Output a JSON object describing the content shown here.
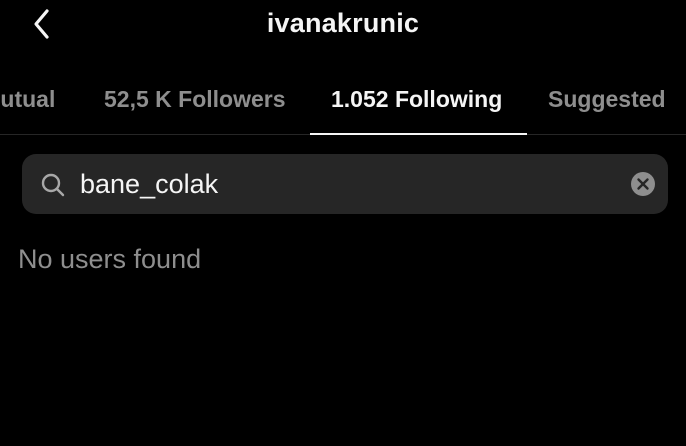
{
  "header": {
    "title": "ivanakrunic",
    "back_icon": "chevron-left-icon"
  },
  "tabs": [
    {
      "label": "Mutual",
      "visible_text": "lutual",
      "active": false
    },
    {
      "label": "52,5 K Followers",
      "active": false
    },
    {
      "label": "1.052 Following",
      "active": true
    },
    {
      "label": "Suggested",
      "active": false
    }
  ],
  "search": {
    "value": "bane_colak",
    "icon": "search-icon",
    "clear_icon": "clear-icon"
  },
  "results": {
    "empty_message": "No users found"
  },
  "colors": {
    "background": "#000000",
    "text_primary": "#f5f5f5",
    "text_secondary": "#8e8e8e",
    "search_background": "#262626"
  }
}
